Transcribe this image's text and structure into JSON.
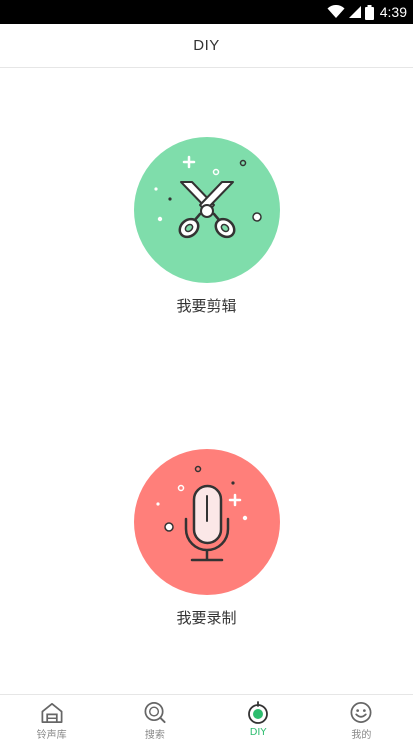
{
  "status_bar": {
    "time": "4:39",
    "icons": [
      "wifi-icon",
      "signal-icon",
      "battery-icon"
    ]
  },
  "header": {
    "title": "DIY"
  },
  "features": [
    {
      "label": "我要剪辑",
      "icon": "scissors-icon",
      "color": "#7fddab"
    },
    {
      "label": "我要录制",
      "icon": "microphone-icon",
      "color": "#ff7f7a"
    }
  ],
  "bottom_nav": {
    "active_index": 2,
    "active_color": "#2dbd6e",
    "items": [
      {
        "label": "铃声库",
        "icon": "house-icon"
      },
      {
        "label": "搜索",
        "icon": "search-icon"
      },
      {
        "label": "DIY",
        "icon": "diy-icon"
      },
      {
        "label": "我的",
        "icon": "smiley-icon"
      }
    ]
  }
}
